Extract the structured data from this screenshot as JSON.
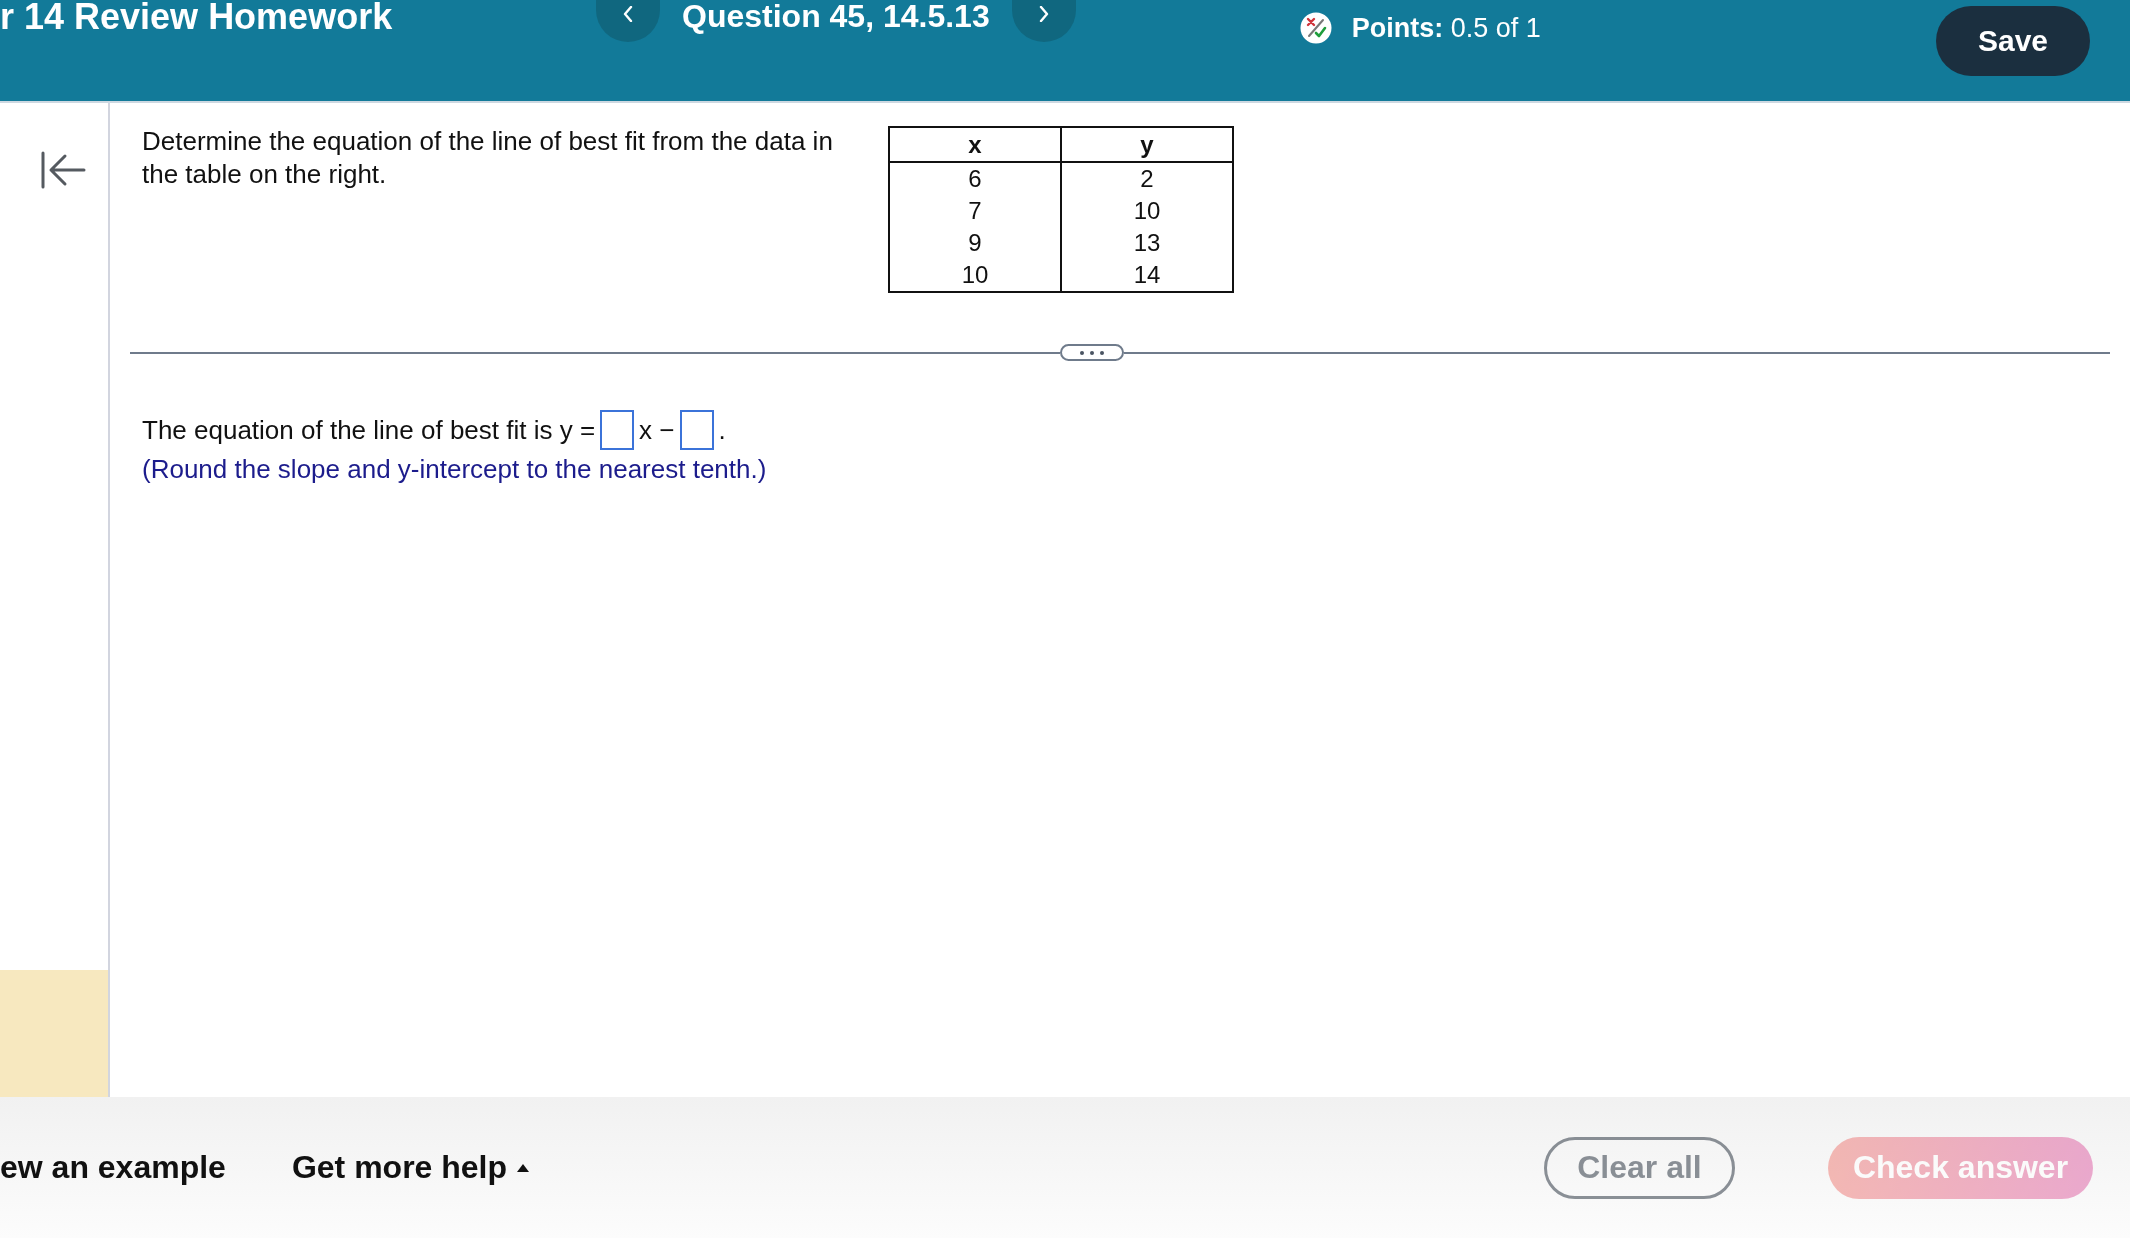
{
  "header": {
    "title": "r 14 Review Homework",
    "question_label": "Question 45, 14.5.13",
    "points": {
      "label": "Points:",
      "value": "0.5 of 1"
    },
    "save_button": "Save"
  },
  "question": {
    "prompt": "Determine the equation of the line of best fit from the data in the table on the right.",
    "table": {
      "columns": [
        "x",
        "y"
      ],
      "rows": [
        [
          "6",
          "2"
        ],
        [
          "7",
          "10"
        ],
        [
          "9",
          "13"
        ],
        [
          "10",
          "14"
        ]
      ]
    }
  },
  "answer": {
    "parts": [
      {
        "kind": "text",
        "text": "The equation of the line of best fit is y ="
      },
      {
        "kind": "blank"
      },
      {
        "kind": "text",
        "text": "x −"
      },
      {
        "kind": "blank"
      },
      {
        "kind": "text",
        "text": "."
      }
    ],
    "hint": "(Round the slope and y-intercept to the nearest tenth.)"
  },
  "footer": {
    "links": [
      {
        "kind": "link",
        "label": "ew an example"
      },
      {
        "kind": "menu",
        "label": "Get more help"
      }
    ],
    "buttons": [
      {
        "kind": "outline",
        "label": "Clear all",
        "disabled": true
      },
      {
        "kind": "primary",
        "label": "Check answer",
        "disabled": true
      }
    ]
  }
}
